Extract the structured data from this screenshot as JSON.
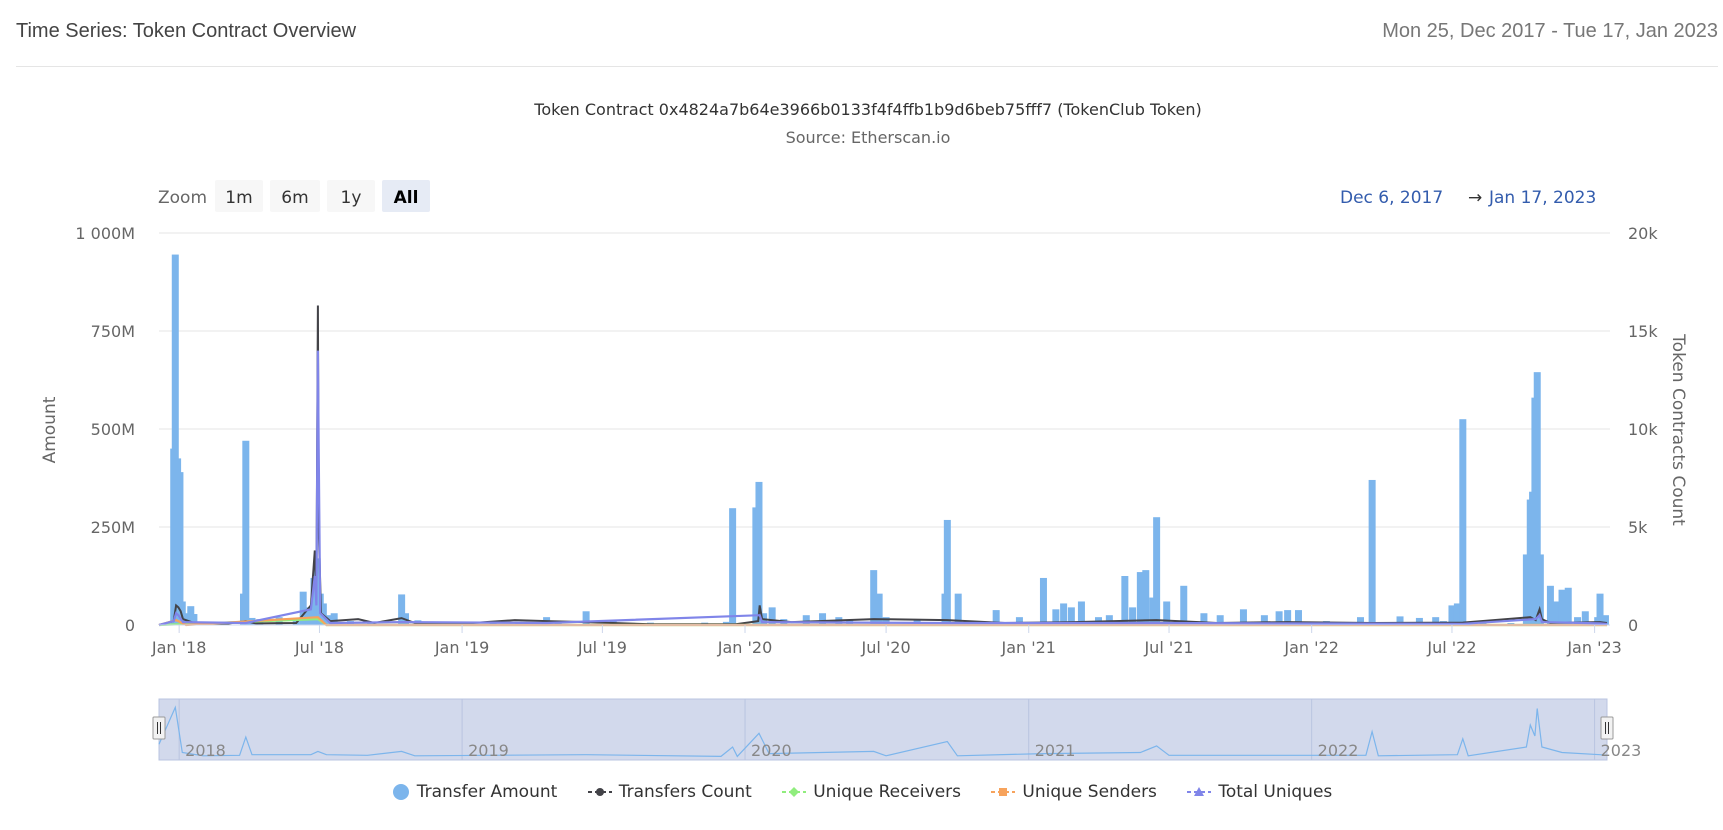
{
  "header": {
    "title": "Time Series: Token Contract Overview",
    "date_range": "Mon 25, Dec 2017 - Tue 17, Jan 2023"
  },
  "zoom": {
    "label": "Zoom",
    "buttons": [
      "1m",
      "6m",
      "1y",
      "All"
    ],
    "active": "All"
  },
  "range_selector": {
    "from": "Dec 6, 2017",
    "arrow": "→",
    "to": "Jan 17, 2023"
  },
  "colors": {
    "transfer_amount": "#7cb5ec",
    "transfers_count": "#434348",
    "unique_receivers": "#90ed7d",
    "unique_senders": "#f7a35c",
    "total_uniques": "#8085e9",
    "navigator_mask": "#cdd5ea"
  },
  "chart_data": {
    "type": "bar",
    "title": "Token Contract 0x4824a7b64e3966b0133f4f4ffb1b9d6beb75fff7 (TokenClub Token)",
    "subtitle": "Source: Etherscan.io",
    "ylabel": "Amount",
    "y2label": "Token Contracts Count",
    "ylim": [
      0,
      1000000000
    ],
    "y2lim": [
      0,
      20000
    ],
    "yticks": [
      {
        "v": 0,
        "label": "0"
      },
      {
        "v": 250000000,
        "label": "250M"
      },
      {
        "v": 500000000,
        "label": "500M"
      },
      {
        "v": 750000000,
        "label": "750M"
      },
      {
        "v": 1000000000,
        "label": "1 000M"
      }
    ],
    "y2ticks": [
      {
        "v": 0,
        "label": "0"
      },
      {
        "v": 5000,
        "label": "5k"
      },
      {
        "v": 10000,
        "label": "10k"
      },
      {
        "v": 15000,
        "label": "15k"
      },
      {
        "v": 20000,
        "label": "20k"
      }
    ],
    "xlim": [
      "2017-12-06",
      "2023-01-17"
    ],
    "xticks": [
      {
        "date": "2018-01-01",
        "label": "Jan '18"
      },
      {
        "date": "2018-07-01",
        "label": "Jul '18"
      },
      {
        "date": "2019-01-01",
        "label": "Jan '19"
      },
      {
        "date": "2019-07-01",
        "label": "Jul '19"
      },
      {
        "date": "2020-01-01",
        "label": "Jan '20"
      },
      {
        "date": "2020-07-01",
        "label": "Jul '20"
      },
      {
        "date": "2021-01-01",
        "label": "Jan '21"
      },
      {
        "date": "2021-07-01",
        "label": "Jul '21"
      },
      {
        "date": "2022-01-01",
        "label": "Jan '22"
      },
      {
        "date": "2022-07-01",
        "label": "Jul '22"
      },
      {
        "date": "2023-01-01",
        "label": "Jan '23"
      }
    ],
    "navigator_labels": [
      {
        "date": "2018-01-01",
        "label": "2018"
      },
      {
        "date": "2019-01-01",
        "label": "2019"
      },
      {
        "date": "2020-01-01",
        "label": "2020"
      },
      {
        "date": "2021-01-01",
        "label": "2021"
      },
      {
        "date": "2022-01-01",
        "label": "2022"
      },
      {
        "date": "2023-01-01",
        "label": "2023"
      }
    ],
    "series": [
      {
        "name": "Transfer Amount",
        "axis": "left",
        "kind": "column",
        "points": [
          [
            "2017-12-25",
            450000000
          ],
          [
            "2017-12-27",
            945000000
          ],
          [
            "2017-12-30",
            425000000
          ],
          [
            "2018-01-02",
            390000000
          ],
          [
            "2018-01-05",
            60000000
          ],
          [
            "2018-01-08",
            30000000
          ],
          [
            "2018-01-12",
            22000000
          ],
          [
            "2018-01-16",
            48000000
          ],
          [
            "2018-01-20",
            28000000
          ],
          [
            "2018-02-10",
            8000000
          ],
          [
            "2018-03-25",
            80000000
          ],
          [
            "2018-03-28",
            470000000
          ],
          [
            "2018-04-05",
            18000000
          ],
          [
            "2018-04-15",
            15000000
          ],
          [
            "2018-05-10",
            20000000
          ],
          [
            "2018-06-01",
            15000000
          ],
          [
            "2018-06-10",
            85000000
          ],
          [
            "2018-06-18",
            45000000
          ],
          [
            "2018-06-24",
            120000000
          ],
          [
            "2018-06-28",
            170000000
          ],
          [
            "2018-07-02",
            80000000
          ],
          [
            "2018-07-06",
            55000000
          ],
          [
            "2018-07-12",
            25000000
          ],
          [
            "2018-07-20",
            30000000
          ],
          [
            "2018-08-10",
            10000000
          ],
          [
            "2018-09-05",
            8000000
          ],
          [
            "2018-10-15",
            78000000
          ],
          [
            "2018-10-20",
            30000000
          ],
          [
            "2018-11-05",
            12000000
          ],
          [
            "2018-12-01",
            6000000
          ],
          [
            "2019-02-10",
            10000000
          ],
          [
            "2019-03-15",
            8000000
          ],
          [
            "2019-04-20",
            20000000
          ],
          [
            "2019-05-05",
            8000000
          ],
          [
            "2019-06-10",
            35000000
          ],
          [
            "2019-07-15",
            12000000
          ],
          [
            "2019-09-01",
            6000000
          ],
          [
            "2019-11-10",
            6000000
          ],
          [
            "2019-12-08",
            8000000
          ],
          [
            "2019-12-16",
            298000000
          ],
          [
            "2020-01-15",
            300000000
          ],
          [
            "2020-01-19",
            365000000
          ],
          [
            "2020-01-25",
            30000000
          ],
          [
            "2020-02-05",
            45000000
          ],
          [
            "2020-02-20",
            15000000
          ],
          [
            "2020-03-20",
            25000000
          ],
          [
            "2020-04-10",
            30000000
          ],
          [
            "2020-05-01",
            20000000
          ],
          [
            "2020-05-15",
            12000000
          ],
          [
            "2020-06-15",
            140000000
          ],
          [
            "2020-06-22",
            80000000
          ],
          [
            "2020-07-01",
            20000000
          ],
          [
            "2020-08-10",
            15000000
          ],
          [
            "2020-09-15",
            80000000
          ],
          [
            "2020-09-18",
            268000000
          ],
          [
            "2020-10-02",
            80000000
          ],
          [
            "2020-11-01",
            10000000
          ],
          [
            "2020-11-20",
            38000000
          ],
          [
            "2020-12-20",
            20000000
          ],
          [
            "2021-01-20",
            120000000
          ],
          [
            "2021-02-05",
            40000000
          ],
          [
            "2021-02-15",
            55000000
          ],
          [
            "2021-02-25",
            45000000
          ],
          [
            "2021-03-10",
            60000000
          ],
          [
            "2021-04-01",
            20000000
          ],
          [
            "2021-04-15",
            25000000
          ],
          [
            "2021-05-05",
            125000000
          ],
          [
            "2021-05-15",
            45000000
          ],
          [
            "2021-05-25",
            135000000
          ],
          [
            "2021-06-01",
            140000000
          ],
          [
            "2021-06-10",
            70000000
          ],
          [
            "2021-06-15",
            275000000
          ],
          [
            "2021-06-28",
            60000000
          ],
          [
            "2021-07-20",
            100000000
          ],
          [
            "2021-08-15",
            30000000
          ],
          [
            "2021-09-05",
            25000000
          ],
          [
            "2021-10-05",
            40000000
          ],
          [
            "2021-11-01",
            25000000
          ],
          [
            "2021-11-20",
            35000000
          ],
          [
            "2021-12-01",
            38000000
          ],
          [
            "2021-12-15",
            38000000
          ],
          [
            "2022-01-20",
            10000000
          ],
          [
            "2022-03-05",
            20000000
          ],
          [
            "2022-03-20",
            370000000
          ],
          [
            "2022-04-25",
            22000000
          ],
          [
            "2022-05-20",
            18000000
          ],
          [
            "2022-06-10",
            20000000
          ],
          [
            "2022-06-20",
            10000000
          ],
          [
            "2022-07-01",
            50000000
          ],
          [
            "2022-07-08",
            55000000
          ],
          [
            "2022-07-15",
            525000000
          ],
          [
            "2022-08-10",
            8000000
          ],
          [
            "2022-09-15",
            5000000
          ],
          [
            "2022-10-05",
            180000000
          ],
          [
            "2022-10-10",
            320000000
          ],
          [
            "2022-10-13",
            340000000
          ],
          [
            "2022-10-16",
            580000000
          ],
          [
            "2022-10-19",
            645000000
          ],
          [
            "2022-10-23",
            180000000
          ],
          [
            "2022-11-05",
            100000000
          ],
          [
            "2022-11-12",
            60000000
          ],
          [
            "2022-11-20",
            90000000
          ],
          [
            "2022-11-28",
            95000000
          ],
          [
            "2022-12-10",
            20000000
          ],
          [
            "2022-12-20",
            35000000
          ],
          [
            "2023-01-05",
            20000000
          ],
          [
            "2023-01-08",
            80000000
          ],
          [
            "2023-01-15",
            25000000
          ]
        ]
      },
      {
        "name": "Transfers Count",
        "axis": "right",
        "kind": "line",
        "points": [
          [
            "2017-12-06",
            0
          ],
          [
            "2017-12-25",
            200
          ],
          [
            "2017-12-28",
            1000
          ],
          [
            "2017-12-31",
            900
          ],
          [
            "2018-01-03",
            700
          ],
          [
            "2018-01-06",
            300
          ],
          [
            "2018-01-20",
            100
          ],
          [
            "2018-03-01",
            50
          ],
          [
            "2018-03-28",
            200
          ],
          [
            "2018-04-10",
            80
          ],
          [
            "2018-06-01",
            100
          ],
          [
            "2018-06-20",
            1000
          ],
          [
            "2018-06-25",
            3800
          ],
          [
            "2018-06-27",
            1500
          ],
          [
            "2018-06-29",
            16300
          ],
          [
            "2018-06-30",
            5000
          ],
          [
            "2018-07-03",
            600
          ],
          [
            "2018-07-15",
            200
          ],
          [
            "2018-08-20",
            300
          ],
          [
            "2018-09-10",
            100
          ],
          [
            "2018-10-15",
            350
          ],
          [
            "2018-11-01",
            100
          ],
          [
            "2019-01-01",
            60
          ],
          [
            "2019-03-10",
            250
          ],
          [
            "2019-04-20",
            200
          ],
          [
            "2019-06-10",
            150
          ],
          [
            "2019-09-01",
            40
          ],
          [
            "2019-12-20",
            40
          ],
          [
            "2020-01-18",
            200
          ],
          [
            "2020-01-20",
            1000
          ],
          [
            "2020-01-23",
            300
          ],
          [
            "2020-03-01",
            150
          ],
          [
            "2020-06-15",
            300
          ],
          [
            "2020-09-18",
            250
          ],
          [
            "2020-12-01",
            100
          ],
          [
            "2021-03-01",
            150
          ],
          [
            "2021-06-15",
            250
          ],
          [
            "2021-09-01",
            100
          ],
          [
            "2021-12-01",
            150
          ],
          [
            "2022-03-20",
            100
          ],
          [
            "2022-07-15",
            120
          ],
          [
            "2022-10-10",
            400
          ],
          [
            "2022-10-17",
            250
          ],
          [
            "2022-10-22",
            800
          ],
          [
            "2022-10-25",
            300
          ],
          [
            "2022-11-05",
            100
          ],
          [
            "2023-01-08",
            150
          ],
          [
            "2023-01-17",
            100
          ]
        ]
      },
      {
        "name": "Unique Receivers",
        "axis": "right",
        "kind": "line",
        "points": [
          [
            "2017-12-06",
            0
          ],
          [
            "2018-06-29",
            300
          ],
          [
            "2018-07-10",
            0
          ],
          [
            "2023-01-17",
            0
          ]
        ]
      },
      {
        "name": "Unique Senders",
        "axis": "right",
        "kind": "line",
        "points": [
          [
            "2017-12-06",
            0
          ],
          [
            "2017-12-28",
            250
          ],
          [
            "2018-01-10",
            0
          ],
          [
            "2018-06-29",
            400
          ],
          [
            "2018-07-10",
            0
          ],
          [
            "2023-01-17",
            0
          ]
        ]
      },
      {
        "name": "Total Uniques",
        "axis": "right",
        "kind": "line",
        "points": [
          [
            "2017-12-06",
            0
          ],
          [
            "2017-12-25",
            200
          ],
          [
            "2017-12-28",
            600
          ],
          [
            "2017-12-31",
            500
          ],
          [
            "2018-01-06",
            150
          ],
          [
            "2018-03-28",
            100
          ],
          [
            "2018-06-20",
            800
          ],
          [
            "2018-06-25",
            2500
          ],
          [
            "2018-06-27",
            1000
          ],
          [
            "2018-06-29",
            14000
          ],
          [
            "2018-06-30",
            9000
          ],
          [
            "2018-07-02",
            600
          ],
          [
            "2018-07-15",
            100
          ],
          [
            "2018-10-15",
            150
          ],
          [
            "2019-04-20",
            100
          ],
          [
            "2020-01-20",
            500
          ],
          [
            "2020-01-23",
            150
          ],
          [
            "2020-09-18",
            100
          ],
          [
            "2021-06-15",
            100
          ],
          [
            "2022-07-15",
            60
          ],
          [
            "2022-10-17",
            300
          ],
          [
            "2022-10-22",
            500
          ],
          [
            "2022-10-25",
            150
          ],
          [
            "2023-01-08",
            80
          ],
          [
            "2023-01-17",
            50
          ]
        ]
      }
    ],
    "navigator_points": [
      [
        "2017-12-06",
        0.25
      ],
      [
        "2017-12-27",
        0.92
      ],
      [
        "2018-01-05",
        0.1
      ],
      [
        "2018-02-01",
        0.04
      ],
      [
        "2018-03-20",
        0.05
      ],
      [
        "2018-03-28",
        0.38
      ],
      [
        "2018-04-05",
        0.06
      ],
      [
        "2018-06-20",
        0.06
      ],
      [
        "2018-06-29",
        0.12
      ],
      [
        "2018-07-10",
        0.06
      ],
      [
        "2018-09-01",
        0.05
      ],
      [
        "2018-10-15",
        0.12
      ],
      [
        "2018-11-01",
        0.04
      ],
      [
        "2019-06-10",
        0.06
      ],
      [
        "2019-12-01",
        0.03
      ],
      [
        "2019-12-16",
        0.2
      ],
      [
        "2019-12-22",
        0.03
      ],
      [
        "2020-01-19",
        0.45
      ],
      [
        "2020-02-01",
        0.08
      ],
      [
        "2020-06-15",
        0.12
      ],
      [
        "2020-07-01",
        0.04
      ],
      [
        "2020-09-18",
        0.3
      ],
      [
        "2020-10-01",
        0.04
      ],
      [
        "2021-01-20",
        0.08
      ],
      [
        "2021-05-25",
        0.1
      ],
      [
        "2021-06-15",
        0.22
      ],
      [
        "2021-07-01",
        0.05
      ],
      [
        "2021-12-01",
        0.05
      ],
      [
        "2022-03-12",
        0.05
      ],
      [
        "2022-03-20",
        0.48
      ],
      [
        "2022-03-28",
        0.04
      ],
      [
        "2022-07-08",
        0.06
      ],
      [
        "2022-07-15",
        0.35
      ],
      [
        "2022-07-22",
        0.04
      ],
      [
        "2022-10-05",
        0.2
      ],
      [
        "2022-10-10",
        0.6
      ],
      [
        "2022-10-16",
        0.4
      ],
      [
        "2022-10-19",
        0.9
      ],
      [
        "2022-10-25",
        0.2
      ],
      [
        "2022-11-20",
        0.1
      ],
      [
        "2023-01-08",
        0.06
      ],
      [
        "2023-01-17",
        0.05
      ]
    ]
  },
  "legend": [
    {
      "label": "Transfer Amount",
      "symbol": "circle",
      "color": "#7cb5ec"
    },
    {
      "label": "Transfers Count",
      "symbol": "line-circle",
      "color": "#434348"
    },
    {
      "label": "Unique Receivers",
      "symbol": "line-diamond",
      "color": "#90ed7d"
    },
    {
      "label": "Unique Senders",
      "symbol": "line-square",
      "color": "#f7a35c"
    },
    {
      "label": "Total Uniques",
      "symbol": "line-triangle",
      "color": "#8085e9"
    }
  ]
}
